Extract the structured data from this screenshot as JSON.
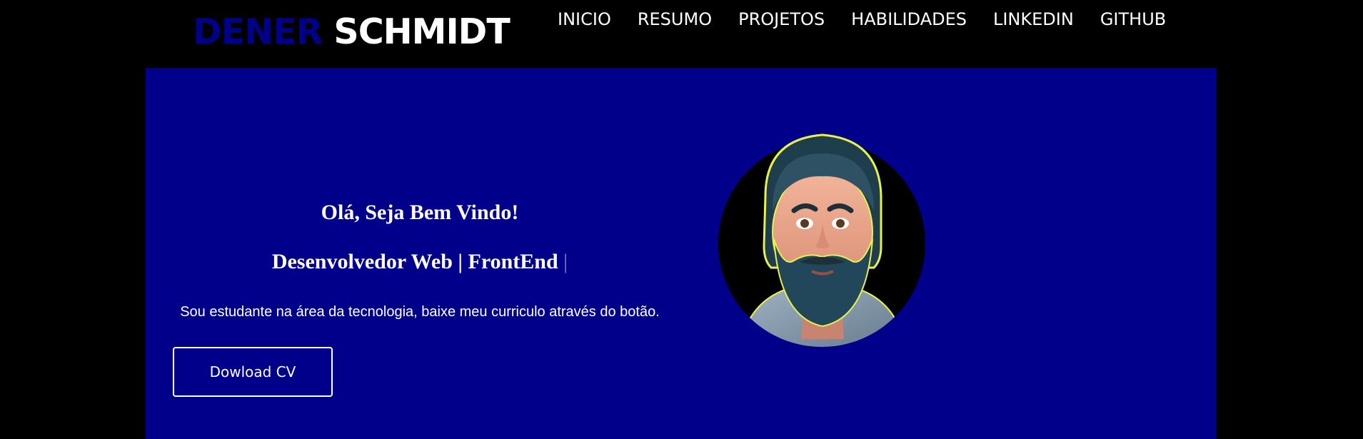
{
  "header": {
    "logo_first": "DENER",
    "logo_last": "SCHMIDT",
    "nav": [
      "INICIO",
      "RESUMO",
      "PROJETOS",
      "HABILIDADES",
      "LINKEDIN",
      "GITHUB"
    ]
  },
  "hero": {
    "greeting": "Olá, Seja Bem Vindo!",
    "role": "Desenvolvedor Web | FrontEnd",
    "cursor": "|",
    "description": "Sou estudante na área da tecnologia, baixe meu curriculo através do botão.",
    "cv_button": "Dowload CV"
  },
  "colors": {
    "page_bg": "#000000",
    "hero_bg": "#00008b",
    "accent": "#00008b",
    "text": "#ffffff"
  },
  "icons": {
    "avatar": "bearded-man-cartoon-avatar"
  }
}
